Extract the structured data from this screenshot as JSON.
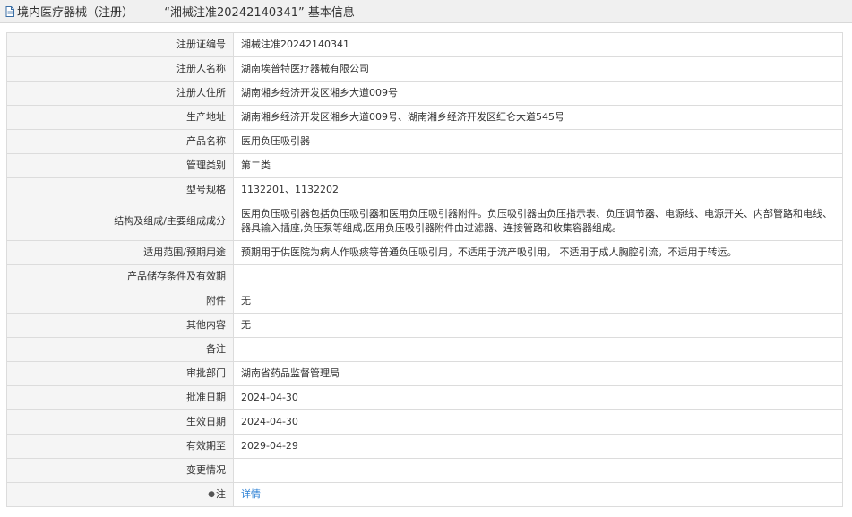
{
  "header": {
    "icon": "document-icon",
    "title": "境内医疗器械（注册） —— “湘械注准20242140341” 基本信息"
  },
  "rows": [
    {
      "label": "注册证编号",
      "value": "湘械注准20242140341"
    },
    {
      "label": "注册人名称",
      "value": "湖南埃普特医疗器械有限公司"
    },
    {
      "label": "注册人住所",
      "value": "湖南湘乡经济开发区湘乡大道009号"
    },
    {
      "label": "生产地址",
      "value": "湖南湘乡经济开发区湘乡大道009号、湖南湘乡经济开发区红仑大道545号"
    },
    {
      "label": "产品名称",
      "value": "医用负压吸引器"
    },
    {
      "label": "管理类别",
      "value": "第二类"
    },
    {
      "label": "型号规格",
      "value": "1132201、1132202"
    },
    {
      "label": "结构及组成/主要组成成分",
      "value": "医用负压吸引器包括负压吸引器和医用负压吸引器附件。负压吸引器由负压指示表、负压调节器、电源线、电源开关、内部管路和电线、器具输入插座,负压泵等组成,医用负压吸引器附件由过滤器、连接管路和收集容器组成。"
    },
    {
      "label": "适用范围/预期用途",
      "value": "预期用于供医院为病人作吸痰等普通负压吸引用，不适用于流产吸引用， 不适用于成人胸腔引流，不适用于转运。"
    },
    {
      "label": "产品储存条件及有效期",
      "value": ""
    },
    {
      "label": "附件",
      "value": "无"
    },
    {
      "label": "其他内容",
      "value": "无"
    },
    {
      "label": "备注",
      "value": ""
    },
    {
      "label": "审批部门",
      "value": "湖南省药品监督管理局"
    },
    {
      "label": "批准日期",
      "value": "2024-04-30"
    },
    {
      "label": "生效日期",
      "value": "2024-04-30"
    },
    {
      "label": "有效期至",
      "value": "2029-04-29"
    },
    {
      "label": "变更情况",
      "value": ""
    }
  ],
  "note": {
    "icon": "pin-icon",
    "label": "注",
    "link_text": "详情"
  },
  "colors": {
    "header_bg": "#f0f0f0",
    "label_bg": "#f5f5f5",
    "border": "#dcdcdc",
    "link": "#2a7fd4"
  }
}
